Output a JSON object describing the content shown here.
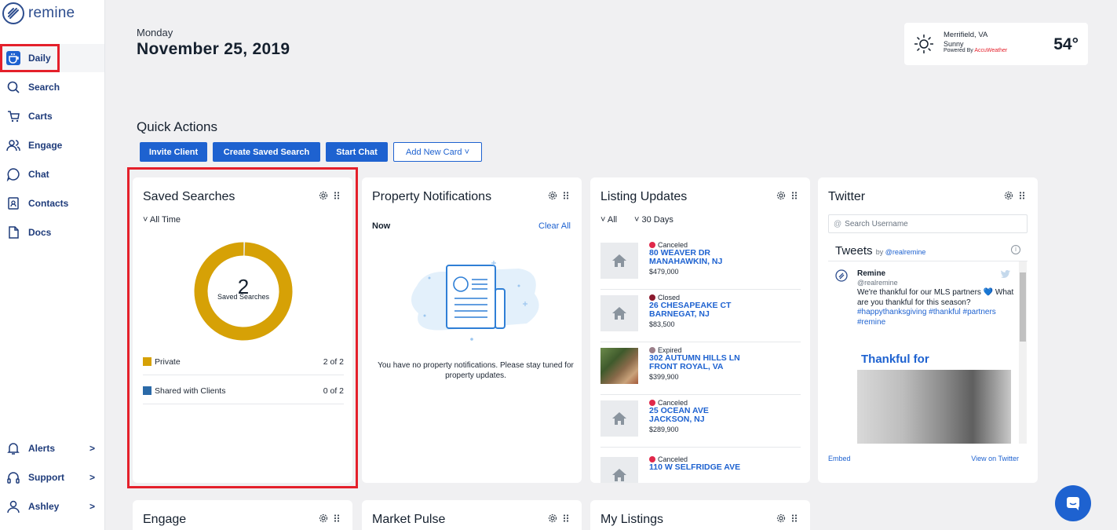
{
  "brand": {
    "name": "remine"
  },
  "sidebar": {
    "items": [
      {
        "label": "Daily",
        "icon": "coffee-cup-icon"
      },
      {
        "label": "Search",
        "icon": "search-icon"
      },
      {
        "label": "Carts",
        "icon": "cart-icon"
      },
      {
        "label": "Engage",
        "icon": "people-icon"
      },
      {
        "label": "Chat",
        "icon": "chat-bubble-icon"
      },
      {
        "label": "Contacts",
        "icon": "contact-card-icon"
      },
      {
        "label": "Docs",
        "icon": "document-icon"
      }
    ],
    "bottom": [
      {
        "label": "Alerts",
        "icon": "bell-icon",
        "chevron": ">"
      },
      {
        "label": "Support",
        "icon": "headphones-icon",
        "chevron": ">"
      },
      {
        "label": "Ashley",
        "icon": "user-icon",
        "chevron": ">"
      }
    ]
  },
  "header": {
    "day": "Monday",
    "date": "November 25, 2019"
  },
  "weather": {
    "location": "Merrifield, VA",
    "condition": "Sunny",
    "powered_by": "Powered By",
    "provider": "AccuWeather",
    "temperature": "54°"
  },
  "quick_actions": {
    "title": "Quick Actions",
    "buttons": [
      "Invite Client",
      "Create Saved Search",
      "Start Chat",
      "Add New Card ˅"
    ]
  },
  "saved_searches": {
    "title": "Saved Searches",
    "filter": "˅  All Time",
    "count": "2",
    "count_label": "Saved Searches",
    "private_fraction": 1.0,
    "legend": [
      {
        "label": "Private",
        "count": "2 of 2",
        "color": "#d6a106"
      },
      {
        "label": "Shared with Clients",
        "count": "0 of 2",
        "color": "#2b6aa8"
      }
    ]
  },
  "property_notifications": {
    "title": "Property Notifications",
    "now": "Now",
    "clear_all": "Clear All",
    "empty_message": "You have no property notifications. Please stay tuned for property updates."
  },
  "listing_updates": {
    "title": "Listing Updates",
    "filter_type": "˅  All",
    "filter_range": "˅  30 Days",
    "items": [
      {
        "status": "Canceled",
        "status_color": "#e0284a",
        "address_line1": "80 WEAVER DR",
        "address_line2": "MANAHAWKIN, NJ",
        "price": "$479,000",
        "photo": false
      },
      {
        "status": "Closed",
        "status_color": "#8b1a2e",
        "address_line1": "26 CHESAPEAKE CT",
        "address_line2": "BARNEGAT, NJ",
        "price": "$83,500",
        "photo": false
      },
      {
        "status": "Expired",
        "status_color": "#9b7f8a",
        "address_line1": "302 AUTUMN HILLS LN",
        "address_line2": "FRONT ROYAL, VA",
        "price": "$399,900",
        "photo": true
      },
      {
        "status": "Canceled",
        "status_color": "#e0284a",
        "address_line1": "25 OCEAN AVE",
        "address_line2": "JACKSON, NJ",
        "price": "$289,900",
        "photo": false
      },
      {
        "status": "Canceled",
        "status_color": "#e0284a",
        "address_line1": "110 W SELFRIDGE AVE",
        "address_line2": "",
        "price": "",
        "photo": false
      }
    ]
  },
  "twitter": {
    "title": "Twitter",
    "search_placeholder": "Search Username",
    "tweets_label": "Tweets",
    "by_label": "by",
    "by_handle": "@realremine",
    "info": "i",
    "tweet": {
      "name": "Remine",
      "handle": "@realremine",
      "text": "We're thankful for our MLS partners 💙 What are you thankful for this season?",
      "tags": "#happythanksgiving #thankful #partners #remine",
      "image_title": "Thankful for"
    },
    "embed": "Embed",
    "view_on": "View on Twitter"
  },
  "bottom_cards": [
    "Engage",
    "Market Pulse",
    "My Listings"
  ],
  "colors": {
    "primary": "#1e62d0",
    "highlight": "#e4202b",
    "donut": "#d6a106"
  }
}
